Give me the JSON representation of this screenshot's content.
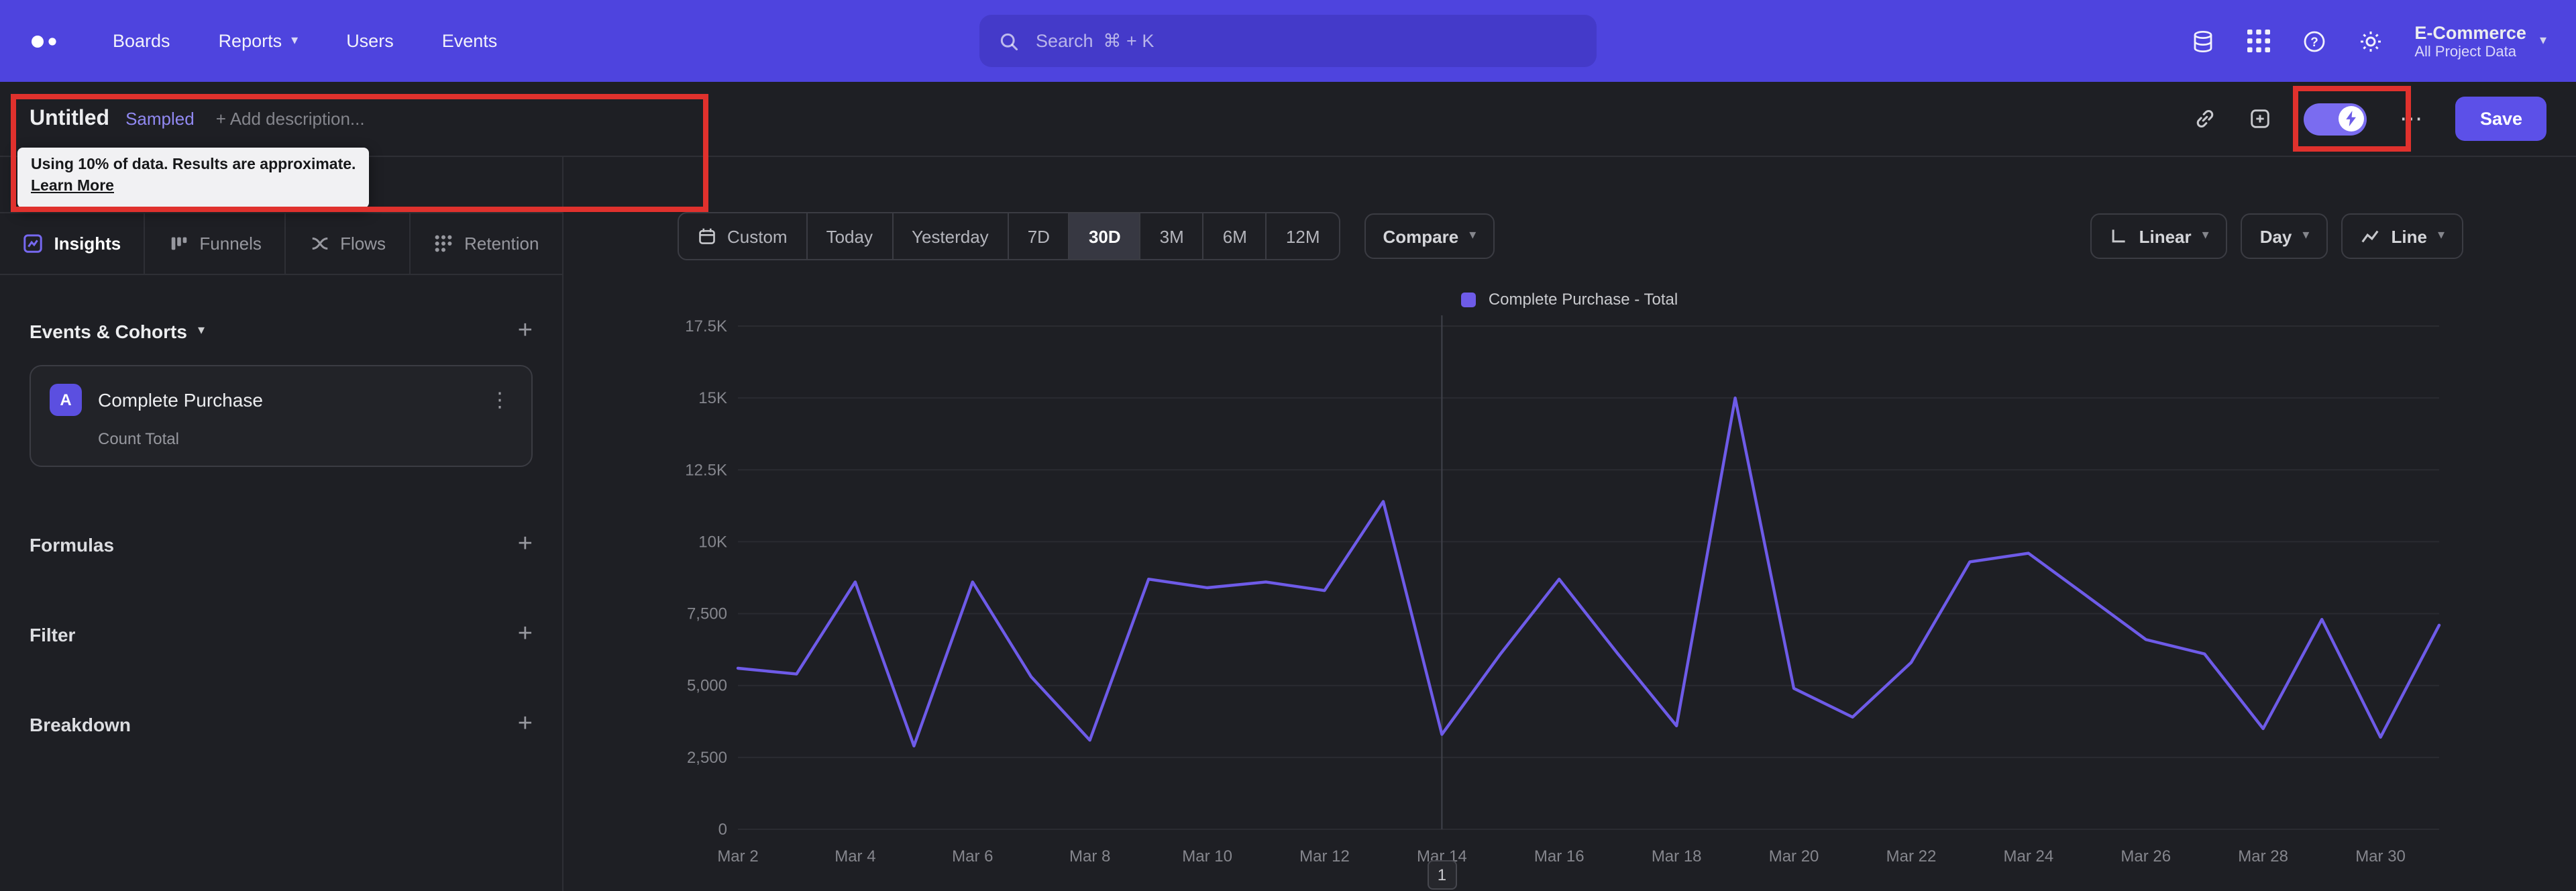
{
  "icons": {
    "chevron_down": "▾",
    "kebab": "⋮",
    "more": "⋯",
    "plus": "+"
  },
  "nav": {
    "links": [
      "Boards",
      "Reports",
      "Users",
      "Events"
    ],
    "dropdown_link": "Reports",
    "search_placeholder": "Search  ⌘ + K",
    "project_name": "E-Commerce",
    "project_subtitle": "All Project Data"
  },
  "report_bar": {
    "title": "Untitled",
    "badge": "Sampled",
    "description_placeholder": "+ Add description...",
    "save_label": "Save"
  },
  "tooltip": {
    "text": "Using 10% of data. Results are approximate.",
    "link": "Learn More"
  },
  "sidebar": {
    "tabs": [
      "Insights",
      "Funnels",
      "Flows",
      "Retention"
    ],
    "active_tab": "Insights",
    "events_header": "Events & Cohorts",
    "event_badge": "A",
    "event_title": "Complete Purchase",
    "event_subtitle": "Count Total",
    "sections": [
      "Formulas",
      "Filter",
      "Breakdown"
    ]
  },
  "toolbar": {
    "ranges": [
      "Custom",
      "Today",
      "Yesterday",
      "7D",
      "30D",
      "3M",
      "6M",
      "12M"
    ],
    "active_range": "30D",
    "compare_label": "Compare",
    "scale_label": "Linear",
    "granularity_label": "Day",
    "chart_type_label": "Line"
  },
  "chart_data": {
    "type": "line",
    "title": "",
    "legend": [
      {
        "label": "Complete Purchase - Total",
        "color": "#6E5BE8"
      }
    ],
    "legend_position": "top-center",
    "grid": true,
    "x": [
      "Mar 2",
      "Mar 3",
      "Mar 4",
      "Mar 5",
      "Mar 6",
      "Mar 7",
      "Mar 8",
      "Mar 9",
      "Mar 10",
      "Mar 11",
      "Mar 12",
      "Mar 13",
      "Mar 14",
      "Mar 15",
      "Mar 16",
      "Mar 17",
      "Mar 18",
      "Mar 19",
      "Mar 20",
      "Mar 21",
      "Mar 22",
      "Mar 23",
      "Mar 24",
      "Mar 25",
      "Mar 26",
      "Mar 27",
      "Mar 28",
      "Mar 29",
      "Mar 30",
      "Mar 31"
    ],
    "series": [
      {
        "name": "Complete Purchase - Total",
        "values": [
          5600,
          5400,
          8600,
          2900,
          8600,
          5300,
          3100,
          8700,
          8400,
          8600,
          8300,
          11400,
          3300,
          6100,
          8700,
          6100,
          3600,
          15000,
          4900,
          3900,
          5800,
          9300,
          9600,
          8100,
          6600,
          6100,
          3500,
          7300,
          3200,
          7100
        ]
      }
    ],
    "ylim": [
      0,
      17500
    ],
    "y_ticks": [
      0,
      2500,
      5000,
      7500,
      10000,
      12500,
      15000,
      17500
    ],
    "y_tick_labels": [
      "0",
      "2,500",
      "5,000",
      "7,500",
      "10K",
      "12.5K",
      "15K",
      "17.5K"
    ],
    "x_tick_indices": [
      0,
      2,
      4,
      6,
      8,
      10,
      12,
      14,
      16,
      18,
      20,
      22,
      24,
      26,
      28
    ],
    "x_tick_labels": [
      "Mar 2",
      "Mar 4",
      "Mar 6",
      "Mar 8",
      "Mar 10",
      "Mar 12",
      "Mar 14",
      "Mar 16",
      "Mar 18",
      "Mar 20",
      "Mar 22",
      "Mar 24",
      "Mar 26",
      "Mar 28",
      "Mar 30"
    ],
    "marker_x_index": 12
  },
  "pagination": "1",
  "colors": {
    "navbar": "#4E44DE",
    "accent": "#6E5BE8",
    "save_button": "#5C50E8",
    "sampled_text": "#9189F2",
    "annotation_red": "#E0312D",
    "background": "#1E1F24"
  }
}
